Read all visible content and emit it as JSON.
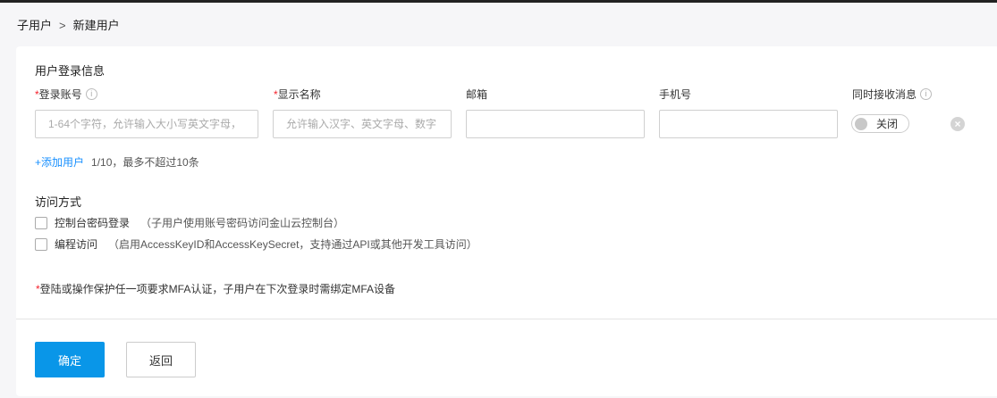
{
  "breadcrumb": {
    "parent": "子用户",
    "separator": ">",
    "current": "新建用户"
  },
  "section_login": {
    "title": "用户登录信息",
    "fields": {
      "login": {
        "label": "登录账号",
        "required": "*",
        "placeholder": "1-64个字符，允许输入大小写英文字母，"
      },
      "display": {
        "label": "显示名称",
        "required": "*",
        "placeholder": "允许输入汉字、英文字母、数字"
      },
      "email": {
        "label": "邮箱",
        "value": ""
      },
      "phone": {
        "label": "手机号",
        "value": ""
      },
      "notify": {
        "label": "同时接收消息",
        "toggle": "关闭"
      }
    },
    "add_user": "+添加用户",
    "count": "1/10，最多不超过10条"
  },
  "section_access": {
    "title": "访问方式",
    "options": [
      {
        "label": "控制台密码登录",
        "hint": "（子用户使用账号密码访问金山云控制台）",
        "checked": false
      },
      {
        "label": "编程访问",
        "hint": "（启用AccessKeyID和AccessKeySecret，支持通过API或其他开发工具访问）",
        "checked": false
      }
    ]
  },
  "note": {
    "star": "*",
    "text": "登陆或操作保护任一项要求MFA认证，子用户在下次登录时需绑定MFA设备"
  },
  "buttons": {
    "confirm": "确定",
    "back": "返回"
  },
  "colors": {
    "primary": "#0996e8",
    "link": "#1890ff",
    "required": "#f5222d"
  }
}
